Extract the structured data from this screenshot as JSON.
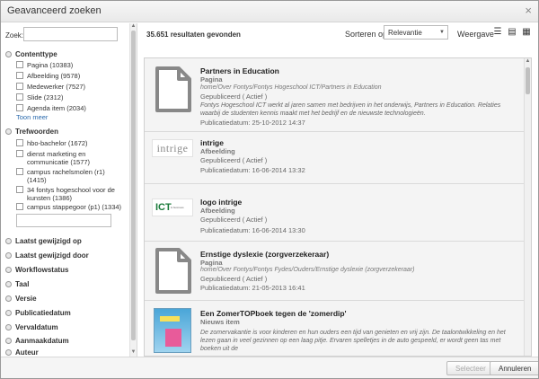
{
  "dialog": {
    "title": "Geavanceerd zoeken",
    "close_glyph": "×"
  },
  "left": {
    "zoek_label": "Zoek:",
    "zoek_value": "",
    "contenttype": {
      "title": "Contenttype",
      "items": [
        "Pagina (10383)",
        "Afbeelding (9578)",
        "Medewerker (7527)",
        "Slide (2312)",
        "Agenda item (2034)"
      ],
      "more": "Toon meer"
    },
    "trefwoorden": {
      "title": "Trefwoorden",
      "items": [
        "hbo-bachelor (1672)",
        "dienst marketing en communicatie (1577)",
        "campus rachelsmolen (r1) (1415)",
        "34 fontys hogeschool voor de kunsten (1386)",
        "campus stappegoor (p1) (1334)"
      ]
    },
    "sections": [
      "Laatst gewijzigd op",
      "Laatst gewijzigd door",
      "Workflowstatus",
      "Taal",
      "Versie",
      "Publicatiedatum",
      "Vervaldatum",
      "Aanmaakdatum",
      "Auteur"
    ]
  },
  "main": {
    "count": "35.651 resultaten gevonden",
    "sort_label": "Sorteren op",
    "sort_value": "Relevantie",
    "view_label": "Weergave",
    "view_icons": [
      "list-view-icon",
      "detail-view-icon",
      "grid-view-icon"
    ]
  },
  "results": [
    {
      "title": "Partners in Education",
      "type": "Pagina",
      "path": "home/Over Fontys/Fontys Hogeschool ICT/Partners in Education",
      "status": "Gepubliceerd ( Actief )",
      "desc": "Fontys Hogeschool ICT werkt al jaren samen met bedrijven in het onderwijs, Partners in Education. Relaties waarbij de studenten kennis maakt met het bedrijf en de nieuwste technologieën.",
      "date": "Publicatiedatum: 25-10-2012 14:37",
      "thumb": "document-icon"
    },
    {
      "title": "intrige",
      "type": "Afbeelding",
      "status": "Gepubliceerd ( Actief )",
      "date": "Publicatiedatum: 16-06-2014 13:32",
      "thumb": "intrige-logo",
      "logo_text": "intrige"
    },
    {
      "title": "logo intrige",
      "type": "Afbeelding",
      "status": "Gepubliceerd ( Actief )",
      "date": "Publicatiedatum: 16-06-2014 13:30",
      "thumb": "ict-logo",
      "logo_text": "ICT",
      "logo_sub": "& business"
    },
    {
      "title": "Ernstige dyslexie (zorgverzekeraar)",
      "type": "Pagina",
      "path": "home/Over Fontys/Fontys Fydes/Ouders/Ernstige dyslexie (zorgverzekeraar)",
      "status": "Gepubliceerd ( Actief )",
      "date": "Publicatiedatum: 21-05-2013 16:41",
      "thumb": "document-icon"
    },
    {
      "title": "Een ZomerTOPboek tegen de 'zomerdip'",
      "type": "Nieuws item",
      "desc": "De zomervakantie is voor kinderen en hun ouders een tijd van genieten en vrij zijn. De taalontwikkeling en het lezen gaan in veel gezinnen op een laag pitje. Ervaren spelletjes in de auto gespeeld, er wordt geen tas met boeken uit de",
      "thumb": "book-cover-image"
    }
  ],
  "footer": {
    "select_label": "Selecteer",
    "cancel_label": "Annuleren"
  }
}
